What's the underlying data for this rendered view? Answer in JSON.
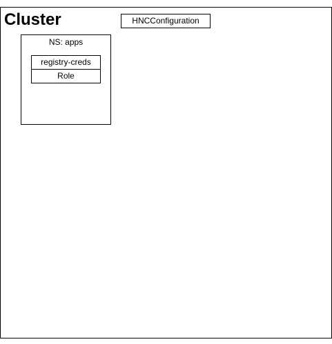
{
  "cluster": {
    "title": "Cluster"
  },
  "hnc_configuration": {
    "label": "HNCConfiguration"
  },
  "namespace": {
    "title": "NS: apps",
    "items": [
      {
        "label": "registry-creds"
      },
      {
        "label": "Role"
      }
    ]
  },
  "colors": {
    "stroke": "#000000",
    "fill": "#ffffff"
  }
}
